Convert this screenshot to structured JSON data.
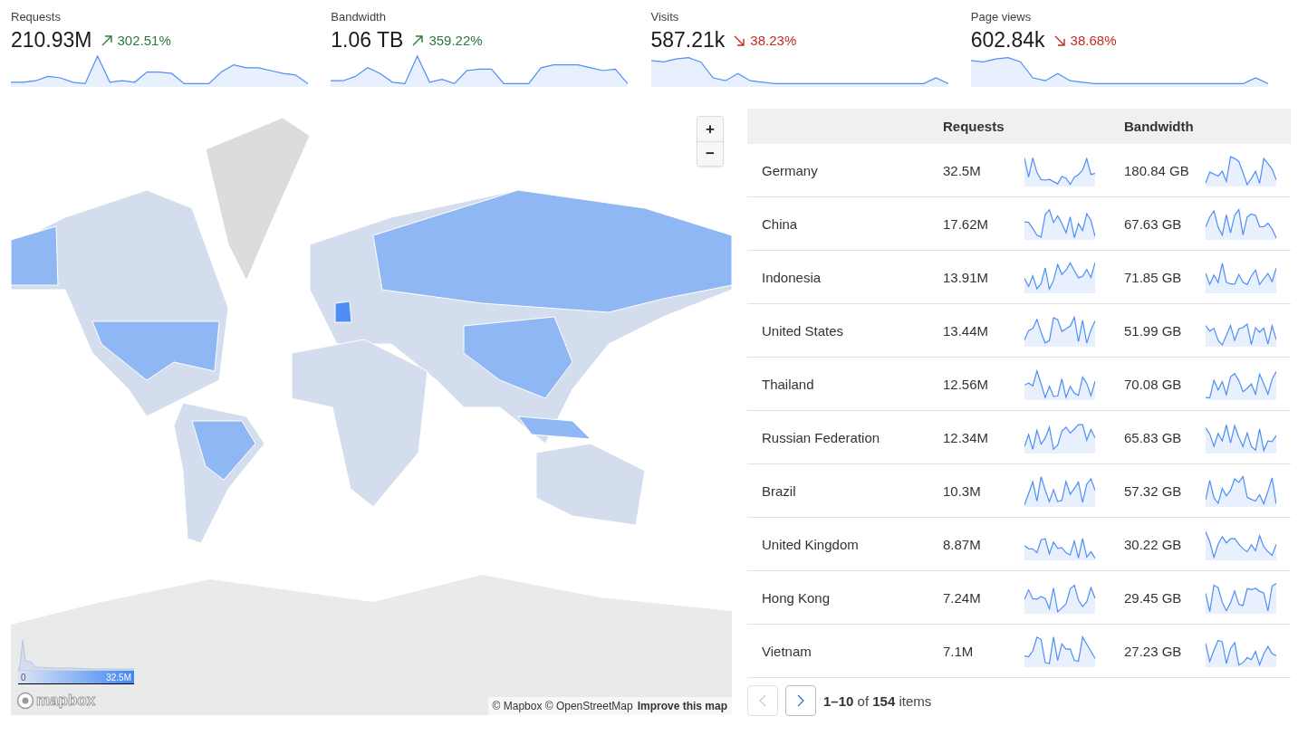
{
  "kpis": [
    {
      "label": "Requests",
      "value": "210.93M",
      "change": "302.51%",
      "kind": "up"
    },
    {
      "label": "Bandwidth",
      "value": "1.06 TB",
      "change": "359.22%",
      "kind": "up"
    },
    {
      "label": "Visits",
      "value": "587.21k",
      "change": "38.23%",
      "kind": "down"
    },
    {
      "label": "Page views",
      "value": "602.84k",
      "change": "38.68%",
      "kind": "down"
    }
  ],
  "map": {
    "zoom_in": "+",
    "zoom_out": "−",
    "legend_min": "0",
    "legend_max": "32.5M",
    "logo": "mapbox",
    "attribution": "© Mapbox © OpenStreetMap",
    "improve_link": "Improve this map"
  },
  "table": {
    "columns": [
      "Requests",
      "Bandwidth"
    ],
    "rows": [
      {
        "country": "Germany",
        "requests": "32.5M",
        "bandwidth": "180.84 GB"
      },
      {
        "country": "China",
        "requests": "17.62M",
        "bandwidth": "67.63 GB"
      },
      {
        "country": "Indonesia",
        "requests": "13.91M",
        "bandwidth": "71.85 GB"
      },
      {
        "country": "United States",
        "requests": "13.44M",
        "bandwidth": "51.99 GB"
      },
      {
        "country": "Thailand",
        "requests": "12.56M",
        "bandwidth": "70.08 GB"
      },
      {
        "country": "Russian Federation",
        "requests": "12.34M",
        "bandwidth": "65.83 GB"
      },
      {
        "country": "Brazil",
        "requests": "10.3M",
        "bandwidth": "57.32 GB"
      },
      {
        "country": "United Kingdom",
        "requests": "8.87M",
        "bandwidth": "30.22 GB"
      },
      {
        "country": "Hong Kong",
        "requests": "7.24M",
        "bandwidth": "29.45 GB"
      },
      {
        "country": "Vietnam",
        "requests": "7.1M",
        "bandwidth": "27.23 GB"
      }
    ]
  },
  "pagination": {
    "prev": {
      "disabled": true
    },
    "next": {
      "disabled": false
    },
    "summary": "**1–10** of **154** items"
  }
}
